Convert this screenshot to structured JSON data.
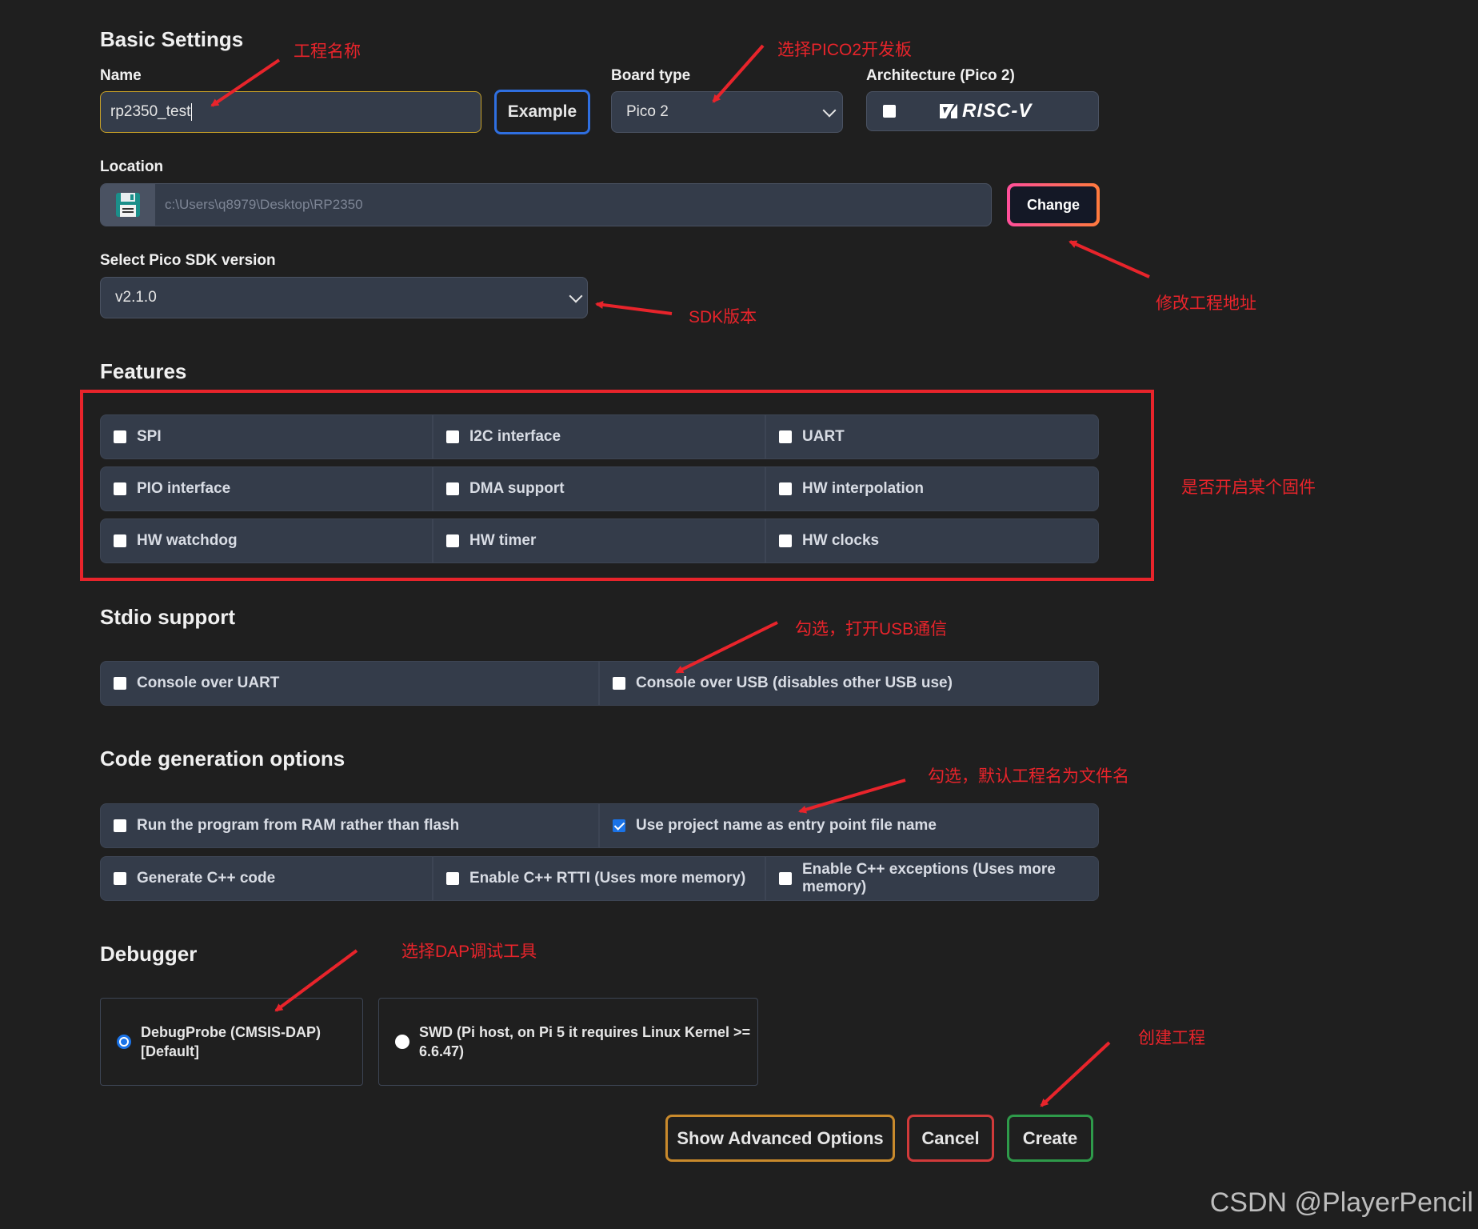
{
  "basic": {
    "heading": "Basic Settings",
    "name_label": "Name",
    "name_value": "rp2350_test",
    "example_button": "Example",
    "board_label": "Board type",
    "board_value": "Pico 2",
    "arch_label": "Architecture (Pico 2)",
    "arch_logo_text": "RISC-V",
    "location_label": "Location",
    "location_placeholder": "c:\\Users\\q8979\\Desktop\\RP2350",
    "change_button": "Change",
    "sdk_label": "Select Pico SDK version",
    "sdk_value": "v2.1.0"
  },
  "features": {
    "heading": "Features",
    "items": [
      "SPI",
      "I2C interface",
      "UART",
      "PIO interface",
      "DMA support",
      "HW interpolation",
      "HW watchdog",
      "HW timer",
      "HW clocks"
    ]
  },
  "stdio": {
    "heading": "Stdio support",
    "items": [
      "Console over UART",
      "Console over USB (disables other USB use)"
    ]
  },
  "codegen": {
    "heading": "Code generation options",
    "row1": [
      "Run the program from RAM rather than flash",
      "Use project name as entry point file name"
    ],
    "row1_checked": [
      false,
      true
    ],
    "row2": [
      "Generate C++ code",
      "Enable C++ RTTI (Uses more memory)",
      "Enable C++ exceptions (Uses more memory)"
    ]
  },
  "debugger": {
    "heading": "Debugger",
    "opt1_line1": "DebugProbe (CMSIS-DAP)",
    "opt1_line2": "[Default]",
    "opt2_line1": "SWD (Pi host, on Pi 5 it requires Linux Kernel >=",
    "opt2_line2": "6.6.47)",
    "selected": "DebugProbe (CMSIS-DAP)"
  },
  "actions": {
    "advanced": "Show Advanced Options",
    "cancel": "Cancel",
    "create": "Create"
  },
  "annotations": {
    "project_name": "工程名称",
    "board": "选择PICO2开发板",
    "location": "修改工程地址",
    "sdk": "SDK版本",
    "features": "是否开启某个固件",
    "usb": "勾选，打开USB通信",
    "entry": "勾选，默认工程名为文件名",
    "dap": "选择DAP调试工具",
    "create": "创建工程"
  },
  "watermark": "CSDN @PlayerPencil",
  "colors": {
    "annotation": "#e8242b",
    "example_border": "#2f6fe0",
    "advanced_border": "#c98a2c",
    "cancel_border": "#d13a3a",
    "create_border": "#2e9a4a"
  }
}
